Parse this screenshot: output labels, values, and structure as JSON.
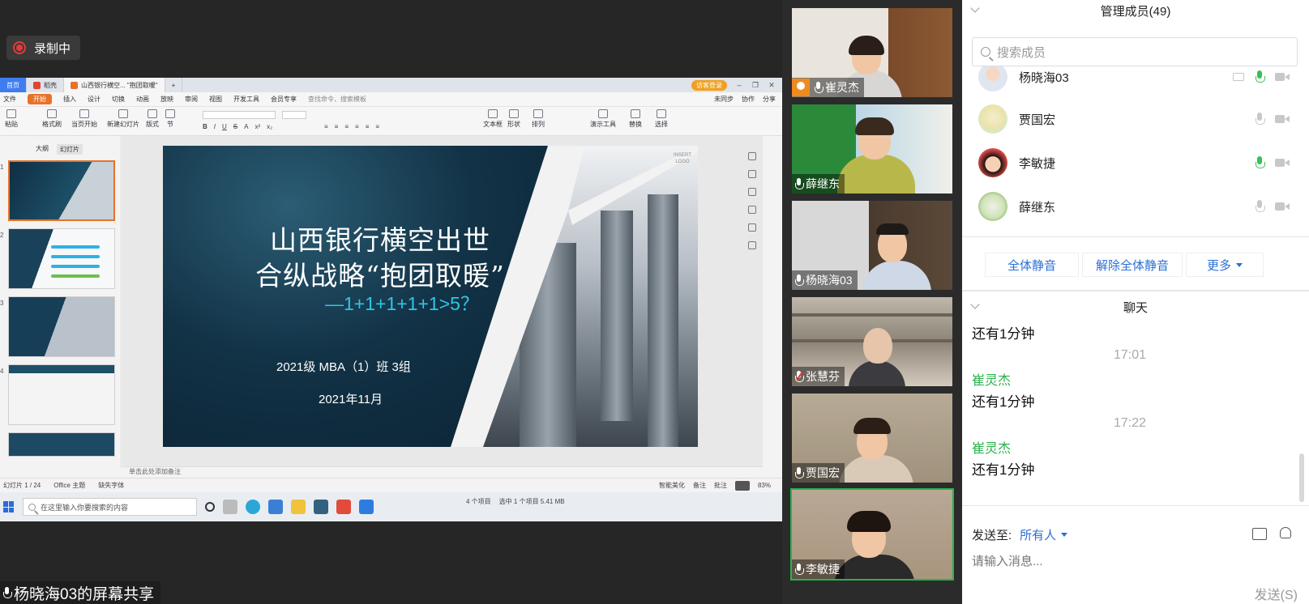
{
  "recording": {
    "label": "录制中"
  },
  "share_label": "杨晓海03的屏幕共享",
  "wps": {
    "tabs": [
      {
        "label": "首页"
      },
      {
        "label": "稻壳"
      },
      {
        "label": "山西银行横空... \"抱团取暖\""
      }
    ],
    "login_label": "访客登录",
    "menu": [
      "文件",
      "开始",
      "插入",
      "设计",
      "切换",
      "动画",
      "放映",
      "审阅",
      "视图",
      "开发工具",
      "会员专享"
    ],
    "menu_search": "查找命令、搜索模板",
    "menu_right": [
      "未同步",
      "协作",
      "分享"
    ],
    "ribbon_big": [
      "粘贴",
      "格式刷",
      "当页开始",
      "新建幻灯片",
      "版式",
      "节",
      "文本框",
      "形状",
      "排列",
      "演示工具",
      "替换",
      "选择"
    ],
    "thumb_tabs": [
      "大纲",
      "幻灯片"
    ],
    "slide": {
      "title_line1": "山西银行横空出世",
      "title_line2": "合纵战略“抱团取暖”",
      "subtitle": "—1+1+1+1+1>5？",
      "class_line": "2021级 MBA（1）班 3组",
      "date": "2021年11月",
      "logo_text": "INSERT LOGO"
    },
    "notes_placeholder": "单击此处添加备注",
    "status": {
      "slide_pos": "幻灯片 1 / 24",
      "theme": "Office 主题",
      "font_missing": "缺失字体",
      "beautify": "智能美化",
      "notes": "备注",
      "comments": "批注",
      "zoom": "83%"
    },
    "taskbar": {
      "search_placeholder": "在这里输入你要搜索的内容",
      "info1": "4 个项目",
      "info2": "选中 1 个项目 5.41 MB"
    }
  },
  "videos": [
    {
      "name": "崔灵杰",
      "host": true,
      "muted": false
    },
    {
      "name": "薛继东",
      "host": false,
      "muted": false
    },
    {
      "name": "杨晓海03",
      "host": false,
      "muted": false
    },
    {
      "name": "张慧芬",
      "host": false,
      "muted": true
    },
    {
      "name": "贾国宏",
      "host": false,
      "muted": false
    },
    {
      "name": "李敏捷",
      "host": false,
      "muted": false
    }
  ],
  "members": {
    "header": "管理成员(49)",
    "search_placeholder": "搜索成员",
    "list": [
      {
        "name": "杨晓海03",
        "mic_active": true
      },
      {
        "name": "贾国宏",
        "mic_active": false
      },
      {
        "name": "李敏捷",
        "mic_active": true
      },
      {
        "name": "薛继东",
        "mic_active": false
      }
    ],
    "actions": {
      "mute_all": "全体静音",
      "unmute_all": "解除全体静音",
      "more": "更多"
    }
  },
  "chat": {
    "header": "聊天",
    "messages": [
      {
        "text": "还有1分钟"
      },
      {
        "time": "17:01",
        "sender": "崔灵杰",
        "text": "还有1分钟"
      },
      {
        "time": "17:22",
        "sender": "崔灵杰",
        "text": "还有1分钟"
      }
    ],
    "send_to_label": "发送至:",
    "send_to_value": "所有人",
    "input_placeholder": "请输入消息...",
    "send_button": "发送(S)"
  },
  "colors": {
    "accent_blue": "#2a6fd6",
    "speaker_green": "#2bb24c",
    "wps_orange": "#e7722a",
    "slide_cyan": "#2ec6e6"
  }
}
